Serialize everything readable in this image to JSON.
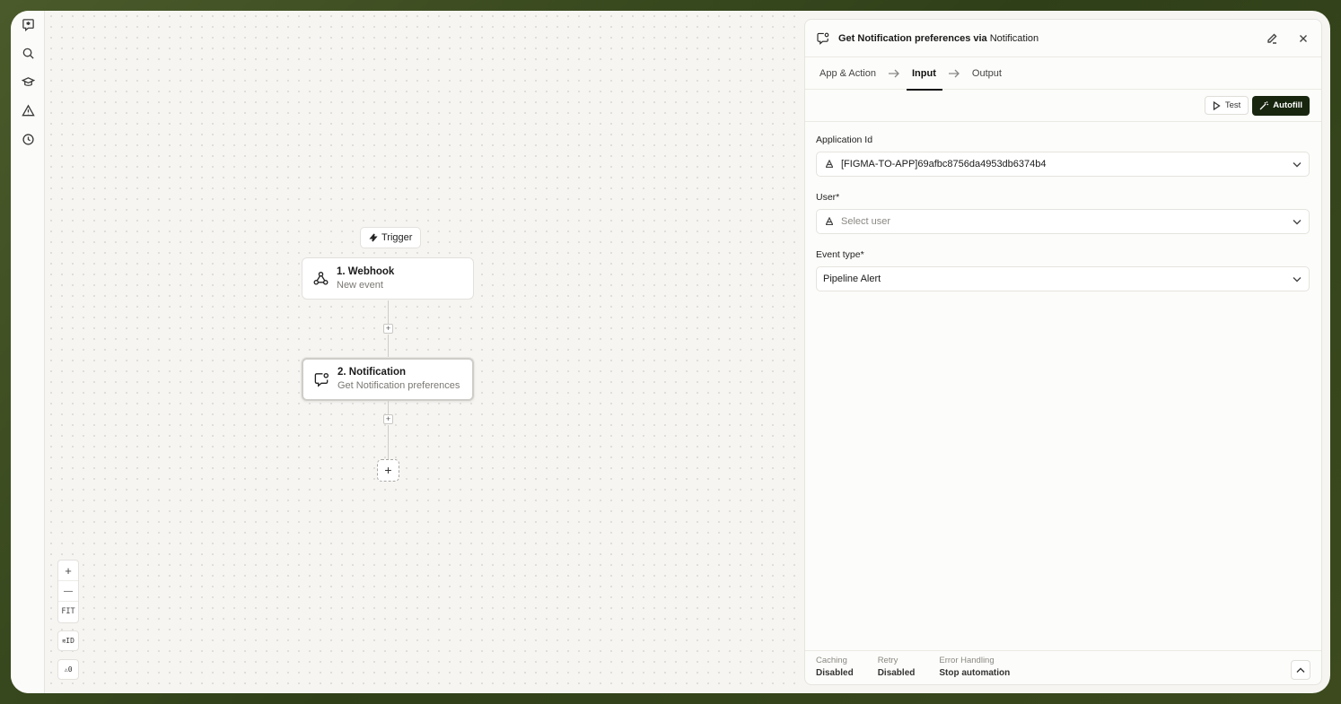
{
  "canvas": {
    "trigger_label": "Trigger",
    "nodes": [
      {
        "title": "1. Webhook",
        "subtitle": "New event"
      },
      {
        "title": "2. Notification",
        "subtitle": "Get Notification preferences"
      }
    ],
    "zoom": {
      "in": "+",
      "out": "—",
      "fit": "FIT"
    },
    "id_toggle": "ID",
    "warnings_count": "0"
  },
  "panel": {
    "title_action": "Get Notification preferences via",
    "title_app": "Notification",
    "tabs": [
      "App & Action",
      "Input",
      "Output"
    ],
    "active_tab": "Input",
    "test_label": "Test",
    "autofill_label": "Autofill",
    "fields": [
      {
        "label": "Application Id",
        "value": "[FIGMA-TO-APP]69afbc8756da4953db6374b4",
        "placeholder": ""
      },
      {
        "label": "User*",
        "value": "",
        "placeholder": "Select user"
      },
      {
        "label": "Event type*",
        "value": "Pipeline Alert",
        "placeholder": ""
      }
    ],
    "footer": [
      {
        "key": "Caching",
        "value": "Disabled"
      },
      {
        "key": "Retry",
        "value": "Disabled"
      },
      {
        "key": "Error Handling",
        "value": "Stop automation"
      }
    ]
  },
  "colors": {
    "accent": "#18260f",
    "frame_bg": "#3c4a1e"
  }
}
